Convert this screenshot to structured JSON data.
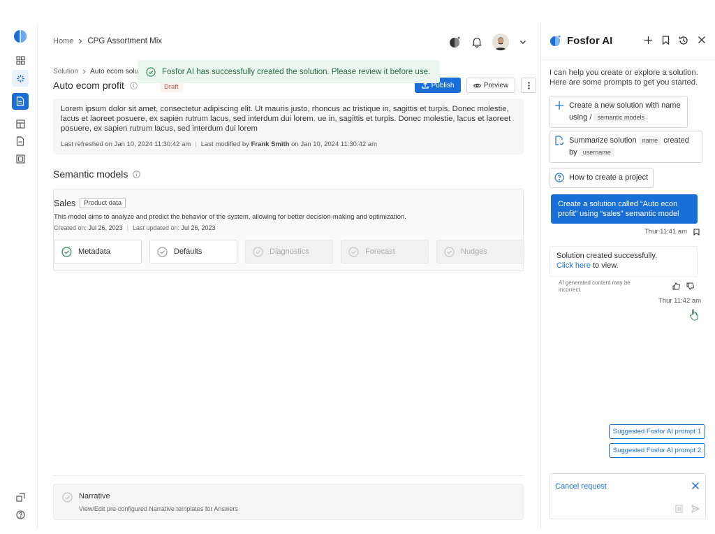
{
  "topbar": {
    "breadcrumb_home": "Home",
    "breadcrumb_current": "CPG Assortment Mix"
  },
  "toast": {
    "message": "Fosfor AI has successfully created the solution. Please review it before use."
  },
  "solution": {
    "crumb_root": "Solution",
    "crumb_current": "Auto ecom solu",
    "title": "Auto ecom  profit",
    "status": "Draft",
    "publish_label": "Publish",
    "preview_label": "Preview",
    "description": "Lorem ipsum dolor sit amet, consectetur adipiscing elit. Ut mauris justo, rhoncus ac tristique in, sagittis et turpis. Donec molestie, lacus et laoreet posuere, ex sapien rutrum lacus, sed interdum dui lorem. ue in, sagittis et turpis. Donec molestie, lacus et laoreet posuere, ex sapien rutrum lacus, sed interdum dui lorem",
    "last_refreshed_label": "Last refreshed on Jan 10, 2024 11:30:42 am",
    "last_modified_prefix": "Last modified by",
    "last_modified_user": "Frank Smith",
    "last_modified_suffix": "on Jan 10, 2024 11:30:42 am"
  },
  "semantic": {
    "heading": "Semantic models",
    "model_name": "Sales",
    "model_tag": "Product data",
    "model_desc": "This model aims to analyze and predict the behavior of the system, allowing for better decision-making and optimization.",
    "created_label": "Created on:",
    "created_date": "Jul 26, 2023",
    "updated_label": "Last updated on:",
    "updated_date": "Jul 26, 2023",
    "steps": [
      {
        "label": "Metadata",
        "state": "done"
      },
      {
        "label": "Defaults",
        "state": "pending"
      },
      {
        "label": "Diagnostics",
        "state": "disabled"
      },
      {
        "label": "Forecast",
        "state": "disabled"
      },
      {
        "label": "Nudges",
        "state": "disabled"
      }
    ]
  },
  "narrative": {
    "title": "Narrative",
    "desc": "View/Edit  pre-configured Narrative templates for Answers"
  },
  "panel": {
    "title": "Fosfor AI",
    "intro": "I can help you create or explore a solution. Here are some prompts to get you started.",
    "prompt1_text": "Create a new solution with name using /",
    "prompt1_chip": "semantic models",
    "prompt2_pre": "Summarize solution",
    "prompt2_chip1": "name",
    "prompt2_mid": "created by",
    "prompt2_chip2": "username",
    "prompt3": "How to create a project",
    "user_message": "Create a solution called “Auto econ profit” using “sales” semantic model",
    "user_time": "Thur 11:41 am",
    "ai_message_pre": "Solution created successfully.",
    "ai_link": "Click here",
    "ai_message_post": "to view.",
    "disclaimer": "AI generated content may be incorrect.",
    "ai_time": "Thur 11:42 am",
    "suggest1": "Suggested Fosfor AI prompt 1",
    "suggest2": "Suggested Fosfor AI prompt 2",
    "cancel": "Cancel request"
  },
  "colors": {
    "accent": "#1a6fd6",
    "toast_bg": "#eaf6ee",
    "toast_text": "#2b6e43",
    "draft_bg": "#fbf1ee"
  },
  "icons": [
    "logo-icon",
    "grid-icon",
    "sparkle-icon",
    "document-icon",
    "layout-icon",
    "file-icon",
    "frame-icon",
    "share-icon",
    "help-icon",
    "ai-icon",
    "bell-icon",
    "chevron-down-icon",
    "plus-icon",
    "bookmark-icon",
    "history-icon",
    "close-icon",
    "info-icon",
    "check-circle-icon",
    "thumbs-up-icon",
    "thumbs-down-icon",
    "send-icon",
    "attachment-icon"
  ]
}
